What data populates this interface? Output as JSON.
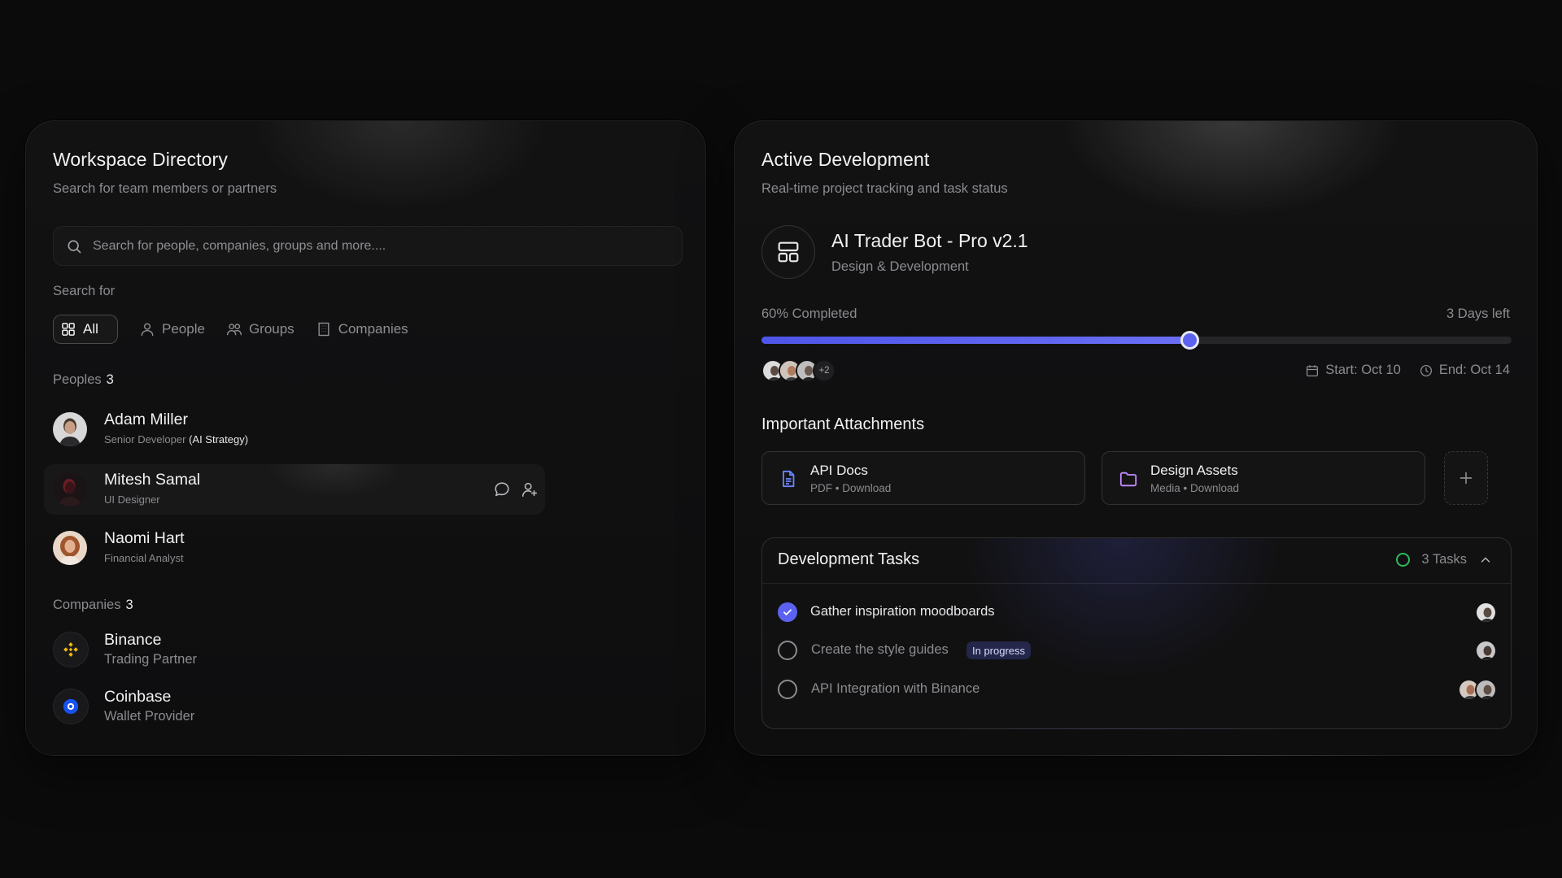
{
  "directory": {
    "title": "Workspace Directory",
    "subtitle": "Search for team members or partners",
    "search_placeholder": "Search for people, companies, groups and more....",
    "search_for_label": "Search for",
    "filters": [
      {
        "label": "All",
        "icon": "grid-icon"
      },
      {
        "label": "People",
        "icon": "user-icon"
      },
      {
        "label": "Groups",
        "icon": "users-icon"
      },
      {
        "label": "Companies",
        "icon": "building-icon"
      }
    ],
    "peoples": {
      "label": "Peoples",
      "count": "3",
      "items": [
        {
          "name": "Adam Miller",
          "role": "Senior Developer",
          "role_extra": "(AI Strategy)"
        },
        {
          "name": "Mitesh Samal",
          "role": "UI Designer"
        },
        {
          "name": "Naomi Hart",
          "role": "Financial Analyst"
        }
      ]
    },
    "companies": {
      "label": "Companies",
      "count": "3",
      "items": [
        {
          "name": "Binance",
          "sub": "Trading Partner",
          "logo_color": "#f0b90b"
        },
        {
          "name": "Coinbase",
          "sub": "Wallet Provider",
          "logo_color": "#1652f0"
        }
      ]
    }
  },
  "development": {
    "title": "Active Development",
    "subtitle": "Real-time project tracking and task status",
    "project": {
      "name": "AI Trader Bot - Pro v2.1",
      "category": "Design & Development"
    },
    "progress": {
      "label": "60% Completed",
      "value": 0.57,
      "days_left": "3 Days left",
      "accent": "#5c62ef"
    },
    "team_more": "+2",
    "start": "Start: Oct 10",
    "end": "End: Oct 14",
    "attachments_title": "Important Attachments",
    "attachments": [
      {
        "title": "API Docs",
        "sub": "PDF • Download",
        "icon": "document-icon",
        "color": "#6a86ff"
      },
      {
        "title": "Design Assets",
        "sub": "Media • Download",
        "icon": "folder-icon",
        "color": "#c58cff"
      }
    ],
    "tasks": {
      "title": "Development Tasks",
      "count_label": "3 Tasks",
      "items": [
        {
          "label": "Gather inspiration moodboards",
          "done": true
        },
        {
          "label": "Create the style guides",
          "done": false,
          "badge": "In progress"
        },
        {
          "label": "API Integration with Binance",
          "done": false
        }
      ]
    }
  }
}
